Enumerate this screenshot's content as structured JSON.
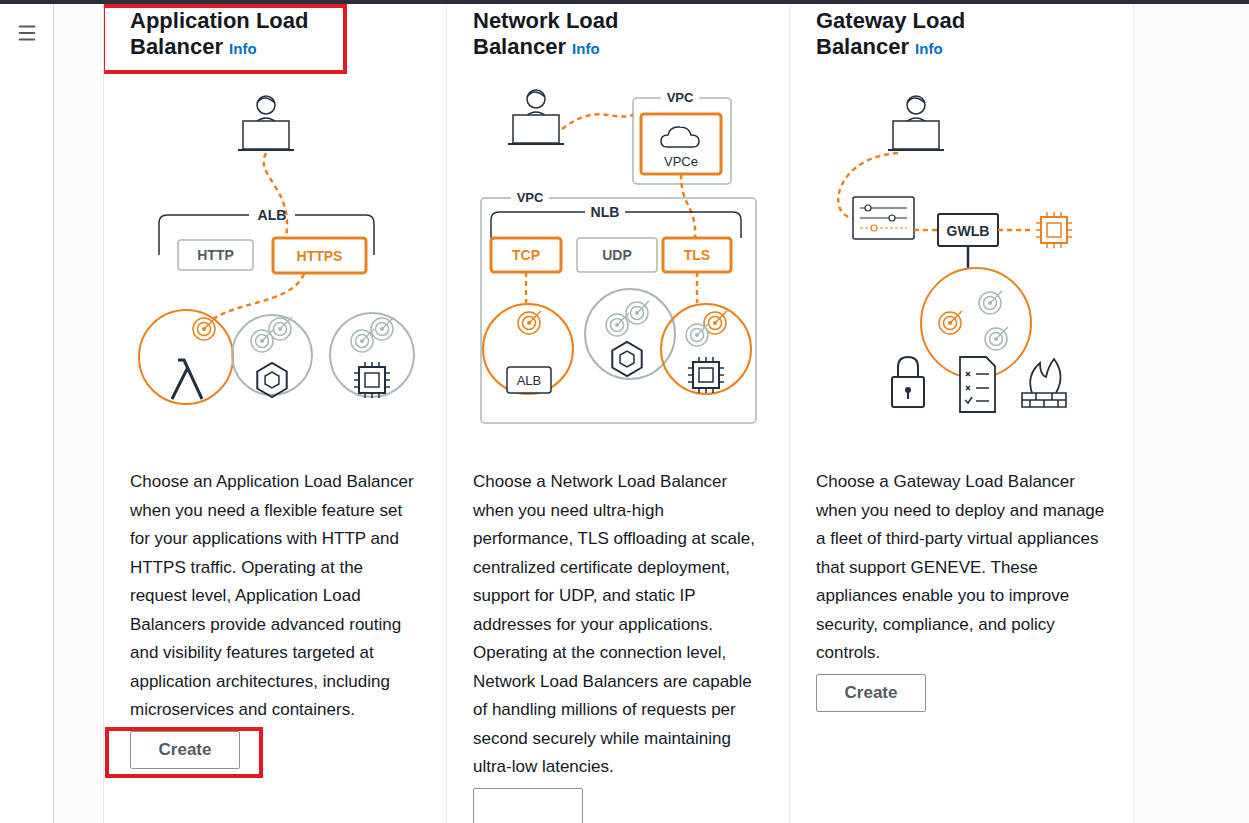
{
  "cards": [
    {
      "title": "Application Load Balancer",
      "info": "Info",
      "title_highlighted": true,
      "diagram": {
        "kind": "alb",
        "bracket": "ALB",
        "listeners": [
          {
            "label": "HTTP",
            "selected": false
          },
          {
            "label": "HTTPS",
            "selected": true
          }
        ]
      },
      "description": "Choose an Application Load Balancer when you need a flexible feature set for your applications with HTTP and HTTPS traffic. Operating at the request level, Application Load Balancers provide advanced routing and visibility features targeted at application architectures, including microservices and containers.",
      "button": {
        "label": "Create",
        "highlighted": true
      }
    },
    {
      "title": "Network Load Balancer",
      "info": "Info",
      "title_highlighted": false,
      "diagram": {
        "kind": "nlb",
        "outer": "VPC",
        "endpoint_vpc": "VPC",
        "endpoint": "VPCe",
        "bracket": "NLB",
        "target": "ALB",
        "listeners": [
          {
            "label": "TCP",
            "selected": true
          },
          {
            "label": "UDP",
            "selected": false
          },
          {
            "label": "TLS",
            "selected": true
          }
        ]
      },
      "description": "Choose a Network Load Balancer when you need ultra-high performance, TLS offloading at scale, centralized certificate deployment, support for UDP, and static IP addresses for your applications. Operating at the connection level, Network Load Balancers are capable of handling millions of requests per second securely while maintaining ultra-low latencies.",
      "button": {
        "label": "",
        "highlighted": false
      }
    },
    {
      "title": "Gateway Load Balancer",
      "info": "Info",
      "title_highlighted": false,
      "diagram": {
        "kind": "gwlb",
        "appliance": "GWLB"
      },
      "description": "Choose a Gateway Load Balancer when you need to deploy and manage a fleet of third-party virtual appliances that support GENEVE. These appliances enable you to improve security, compliance, and policy controls.",
      "button": {
        "label": "Create",
        "highlighted": false
      }
    }
  ]
}
